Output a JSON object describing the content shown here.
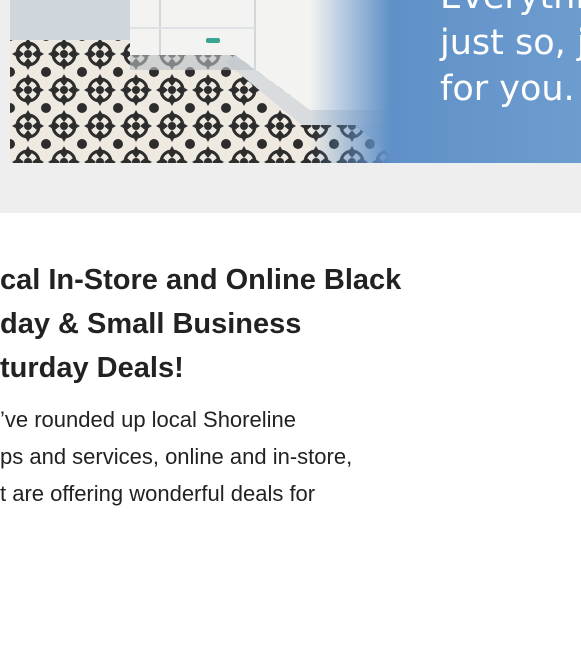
{
  "ad": {
    "tagline_lines": [
      "Everything",
      "just so, just",
      "for you."
    ],
    "colors": {
      "band_background": "#eeeeee",
      "banner_blue": "#5f90c7",
      "text": "#ffffff"
    }
  },
  "article": {
    "headline_lines": [
      "cal In-Store and Online Black",
      "day & Small Business",
      "turday Deals!"
    ],
    "body_lines": [
      "’ve rounded up local Shoreline",
      "ps and services, online and in-store,",
      "t are offering wonderful deals for"
    ],
    "colors": {
      "text": "#222222"
    }
  }
}
